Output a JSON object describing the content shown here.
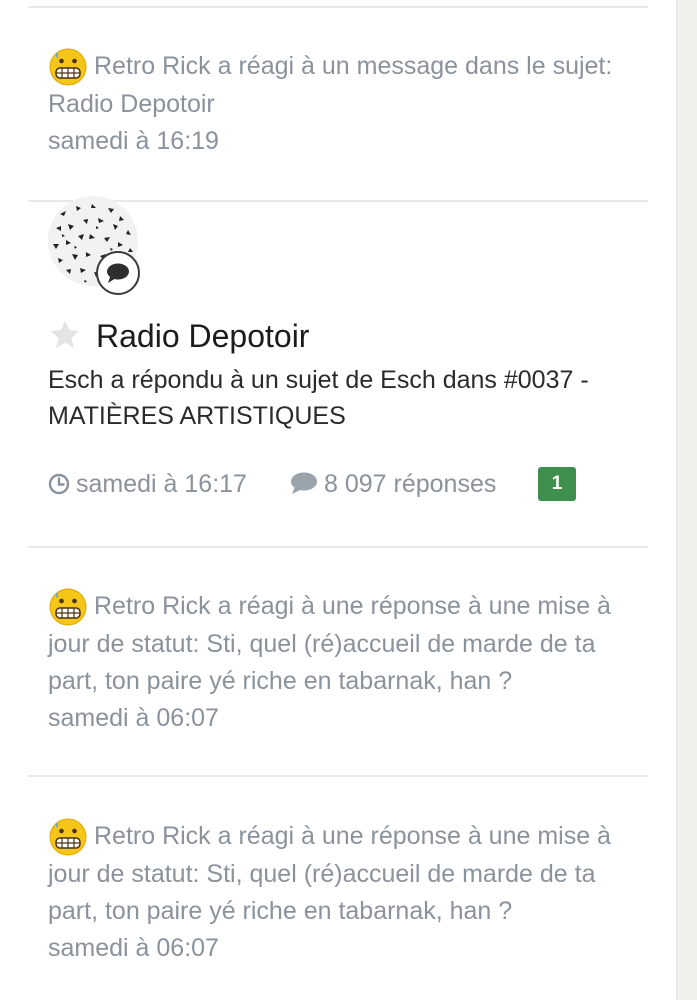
{
  "activity": [
    {
      "icon": "grimace-emoji-icon",
      "text": "Retro Rick a réagi à un message dans le sujet: Radio Depotoir",
      "time": "samedi à 16:19"
    },
    {
      "icon": "grimace-emoji-icon",
      "text": "Retro Rick a réagi à une réponse à une mise à jour de statut: Sti, quel (ré)accueil de marde de ta part, ton paire yé riche en tabarnak, han ?",
      "time": "samedi à 06:07"
    },
    {
      "icon": "grimace-emoji-icon",
      "text": "Retro Rick a réagi à une réponse à une mise à jour de statut: Sti, quel (ré)accueil de marde de ta part, ton paire yé riche en tabarnak, han ?",
      "time": "samedi à 06:07"
    }
  ],
  "topic": {
    "title": "Radio Depotoir",
    "summary": "Esch a répondu à un sujet de Esch dans #0037 - MATIÈRES ARTISTIQUES",
    "time": "samedi à 16:17",
    "replies": "8 097 réponses",
    "unread_count": "1",
    "icons": {
      "badge": "comment-icon",
      "follow": "star-icon",
      "time": "clock-icon",
      "replies": "comment-icon"
    }
  },
  "colors": {
    "muted_text": "#8a929c",
    "unread_badge": "#3f8f4f",
    "divider": "#e8e8e8"
  }
}
